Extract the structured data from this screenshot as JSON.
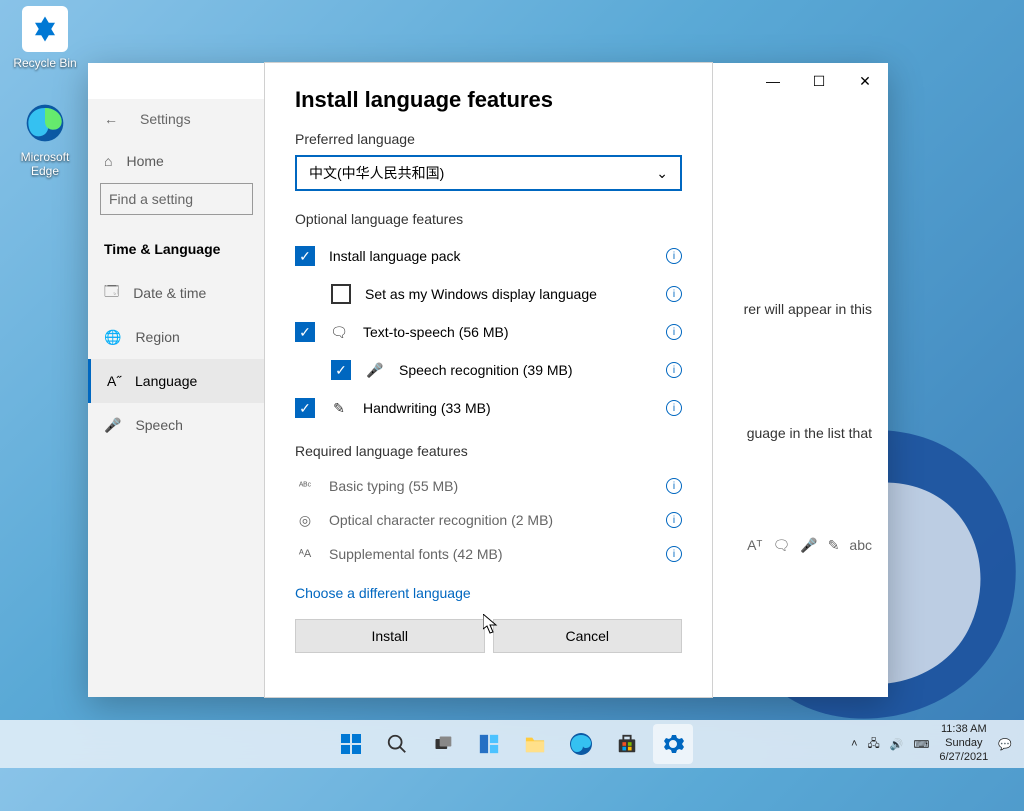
{
  "desktop": {
    "icons": [
      {
        "label": "Recycle Bin"
      },
      {
        "label": "Microsoft Edge"
      }
    ]
  },
  "window": {
    "title": "Settings",
    "back": "←",
    "minimize": "—",
    "maximize": "☐",
    "close": "✕"
  },
  "sidebar": {
    "home": "Home",
    "searchPlaceholder": "Find a setting",
    "section": "Time & Language",
    "items": [
      {
        "label": "Date & time",
        "active": false
      },
      {
        "label": "Region",
        "active": false
      },
      {
        "label": "Language",
        "active": true
      },
      {
        "label": "Speech",
        "active": false
      }
    ]
  },
  "bg": {
    "line1": "rer will appear in this",
    "line2": "guage in the list that"
  },
  "dialog": {
    "title": "Install language features",
    "prefLabel": "Preferred language",
    "selected": "中文(中华人民共和国)",
    "chevron": "⌄",
    "optionalHead": "Optional language features",
    "features": [
      {
        "checkbox": true,
        "checked": true,
        "icon": "",
        "label": "Install language pack",
        "indent": false
      },
      {
        "checkbox": true,
        "checked": false,
        "icon": "",
        "label": "Set as my Windows display language",
        "indent": true
      },
      {
        "checkbox": true,
        "checked": true,
        "icon": "speech-bubble",
        "label": "Text-to-speech (56 MB)",
        "indent": false
      },
      {
        "checkbox": true,
        "checked": true,
        "icon": "mic",
        "label": "Speech recognition (39 MB)",
        "indent": true
      },
      {
        "checkbox": true,
        "checked": true,
        "icon": "pen",
        "label": "Handwriting (33 MB)",
        "indent": false
      }
    ],
    "requiredHead": "Required language features",
    "required": [
      {
        "icon": "abc",
        "label": "Basic typing (55 MB)"
      },
      {
        "icon": "ocr",
        "label": "Optical character recognition (2 MB)"
      },
      {
        "icon": "font",
        "label": "Supplemental fonts (42 MB)"
      }
    ],
    "chooseDifferent": "Choose a different language",
    "install": "Install",
    "cancel": "Cancel",
    "info": "i"
  },
  "taskbar": {
    "time": "11:38 AM",
    "day": "Sunday",
    "date": "6/27/2021"
  }
}
